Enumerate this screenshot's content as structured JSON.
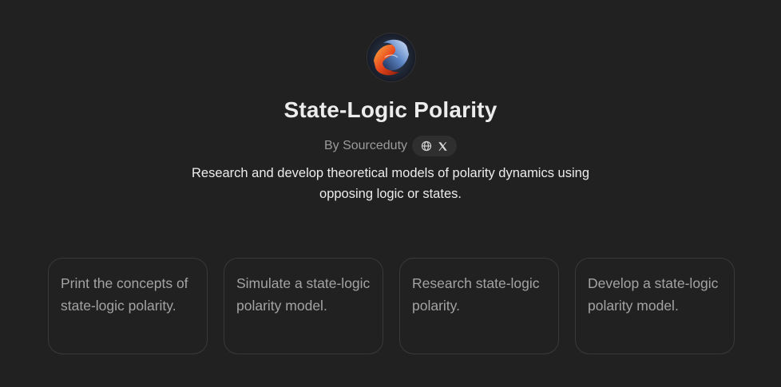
{
  "gpt": {
    "name": "State-Logic Polarity",
    "byline": "By Sourceduty",
    "description": "Research and develop theoretical models of polarity dynamics using opposing logic or states.",
    "social_icons": [
      "globe-icon",
      "x-logo-icon"
    ]
  },
  "conversation_starters": [
    {
      "text": "Print the concepts of state-logic polarity."
    },
    {
      "text": "Simulate a state-logic polarity model."
    },
    {
      "text": "Research state-logic polarity."
    },
    {
      "text": "Develop a state-logic polarity model."
    }
  ],
  "colors": {
    "background": "#212121",
    "title": "#ececec",
    "muted": "#9b9b9b",
    "card_border": "#3a3a3a",
    "card_text": "#a3a3a3"
  }
}
